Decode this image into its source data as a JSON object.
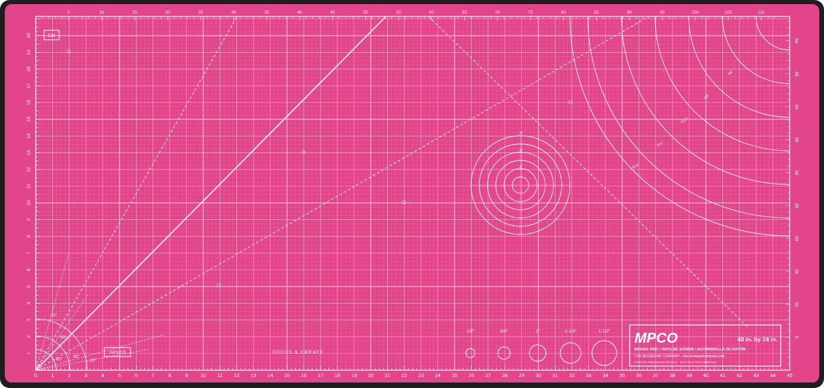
{
  "mat": {
    "colors": {
      "border": "#1e1e1e",
      "surface": "#e2458a",
      "lines": "#ffffff"
    },
    "unit_labels": {
      "cm": "CM",
      "inches": "INCHES"
    },
    "tagline": "FOCUS & CREATE",
    "angles": [
      "75°",
      "60°",
      "45°",
      "30°",
      "15°"
    ],
    "top_cm_ticks": [
      "5",
      "10",
      "15",
      "20",
      "25",
      "30",
      "35",
      "40",
      "45",
      "50",
      "55",
      "60",
      "65",
      "70",
      "75",
      "80",
      "85",
      "90",
      "95",
      "100",
      "105",
      "110"
    ],
    "bottom_inch_ticks": [
      "0",
      "1",
      "2",
      "3",
      "4",
      "5",
      "6",
      "7",
      "8",
      "9",
      "10",
      "11",
      "12",
      "13",
      "14",
      "15",
      "16",
      "17",
      "18",
      "19",
      "20",
      "21",
      "22",
      "23",
      "24",
      "25",
      "26",
      "27",
      "28",
      "29",
      "30",
      "31",
      "32",
      "33",
      "34",
      "35",
      "36",
      "37",
      "38",
      "39",
      "40",
      "41",
      "42",
      "43",
      "44",
      "45"
    ],
    "left_inch_ticks": [
      "1",
      "2",
      "3",
      "4",
      "5",
      "6",
      "7",
      "8",
      "9",
      "10",
      "11",
      "12",
      "13",
      "14",
      "15",
      "16",
      "17",
      "18",
      "19",
      "20"
    ],
    "right_cm_ticks": [
      "5",
      "10",
      "15",
      "20",
      "25",
      "30",
      "35",
      "40",
      "45",
      "50"
    ],
    "circle_labels": [
      "6\"",
      "4\"",
      "2\""
    ],
    "arc_labels": [
      "R12\"",
      "R11\"",
      "R10\"",
      "R9\"",
      "R8\""
    ],
    "size_circles": [
      "1/2\"",
      "3/4\"",
      "1\"",
      "1-1/4\"",
      "1-1/2\""
    ],
    "brand": {
      "logo": "MPCO",
      "size": "48 in. by 24 in.",
      "line1": "MOUSE PAD / TAPIS DE SOURIS / ALFOMBRILLA DE RATÓN",
      "line2": "THE MOUSEPAD COMPANY · themousepadcompany.com",
      "line3": "PRINTED PRECISION GRAPHIC · NOT A CUTTING SURFACE"
    }
  }
}
